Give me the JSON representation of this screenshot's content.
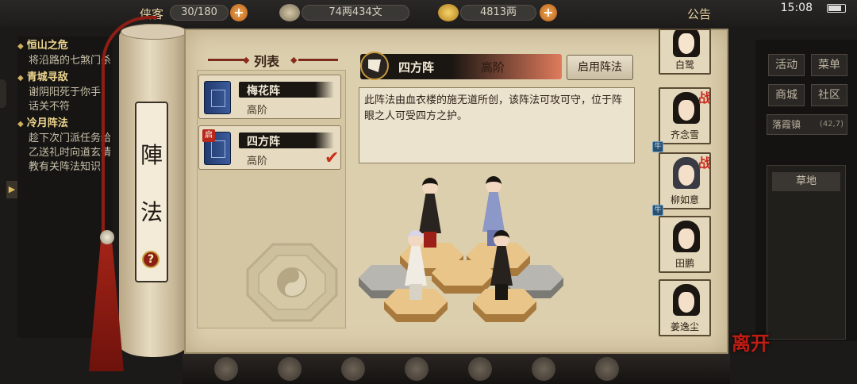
{
  "hud": {
    "capacity_label": "侠客",
    "capacity": "30/180",
    "money": "74两434文",
    "gold": "4813两",
    "notice_label": "公告",
    "time": "15:08"
  },
  "quests": [
    {
      "title": "恒山之危",
      "body": "将沿路的七煞门杀"
    },
    {
      "title": "青城寻敌",
      "body": "谢阴阳死于你手，话关不符"
    },
    {
      "title": "冷月阵法",
      "body": "趁下次门派任务给乙送礼时向道玄请教有关阵法知识"
    }
  ],
  "scroll": {
    "title_char_1": "陣",
    "title_char_2": "法",
    "help": "?"
  },
  "list": {
    "title": "列表",
    "items": [
      {
        "name": "梅花阵",
        "rank": "高阶",
        "selected": false
      },
      {
        "name": "四方阵",
        "rank": "高阶",
        "selected": true,
        "tag": "启"
      }
    ]
  },
  "detail": {
    "name": "四方阵",
    "rank": "高阶",
    "enable_button": "启用阵法",
    "description": "此阵法由血衣楼的施无道所创，该阵法可攻可守，位于阵眼之人可受四方之护。"
  },
  "roster": [
    {
      "name": "白鹭",
      "battle": false,
      "linked": false
    },
    {
      "name": "齐念雪",
      "battle": true,
      "linked": true
    },
    {
      "name": "柳如意",
      "battle": true,
      "linked": true
    },
    {
      "name": "田鹏",
      "battle": false,
      "linked": false
    },
    {
      "name": "姜逸尘",
      "battle": false,
      "linked": false
    }
  ],
  "battle_badge": "战",
  "link_chip": "牛",
  "right_menu": {
    "activity": "活动",
    "menu": "菜单",
    "shop": "商城",
    "community": "社区",
    "location": "落霞镇",
    "coords": "(42,7)",
    "terrain": "草地"
  },
  "leave_button": "离开",
  "colors": {
    "parchment": "#dccfae",
    "accent_red": "#c8301a",
    "header_dark": "#1a1612",
    "header_fade": "#e07b5c"
  }
}
